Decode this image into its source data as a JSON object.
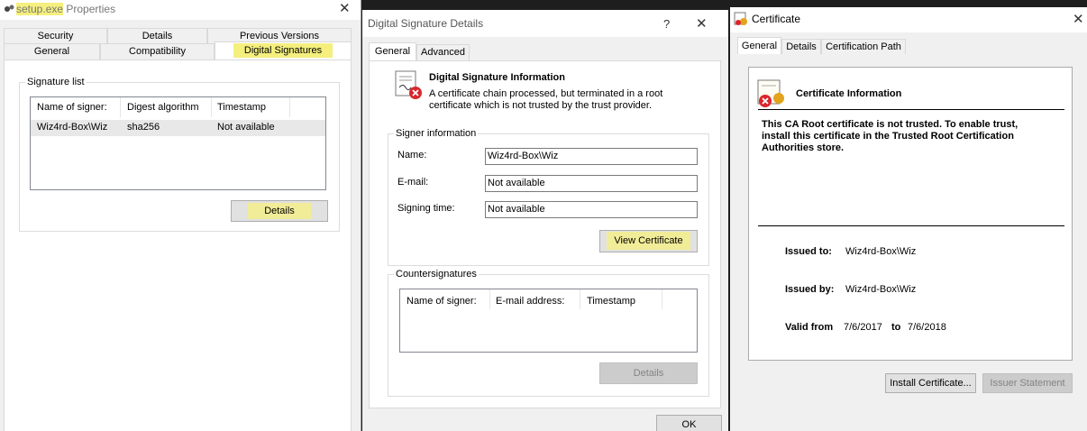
{
  "properties": {
    "title_file": "setup.exe",
    "title_rest": " Properties",
    "tabs_row1": [
      "Security",
      "Details",
      "Previous Versions"
    ],
    "tabs_row2": [
      "General",
      "Compatibility",
      "Digital Signatures"
    ],
    "signature_list_label": "Signature list",
    "columns": [
      "Name of signer:",
      "Digest algorithm",
      "Timestamp"
    ],
    "row": [
      "Wiz4rd-Box\\Wiz",
      "sha256",
      "Not available"
    ],
    "details_button": "Details"
  },
  "sig_details": {
    "title": "Digital Signature Details",
    "help_icon": "?",
    "tabs": [
      "General",
      "Advanced"
    ],
    "info_heading": "Digital Signature Information",
    "info_text_1": "A certificate chain processed, but terminated in a root",
    "info_text_2": "certificate which is not trusted by the trust provider.",
    "signer_group": "Signer information",
    "name_label": "Name:",
    "name_value": "Wiz4rd-Box\\Wiz",
    "email_label": "E-mail:",
    "email_value": "Not available",
    "signing_time_label": "Signing time:",
    "signing_time_value": "Not available",
    "view_certificate_button": "View Certificate",
    "countersig_group": "Countersignatures",
    "countersig_columns": [
      "Name of signer:",
      "E-mail address:",
      "Timestamp"
    ],
    "details_button": "Details",
    "ok_button": "OK"
  },
  "certificate": {
    "title": "Certificate",
    "tabs": [
      "General",
      "Details",
      "Certification Path"
    ],
    "info_heading": "Certificate Information",
    "warning_1": "This CA Root certificate is not trusted. To enable trust,",
    "warning_2": "install this certificate in the Trusted Root Certification",
    "warning_3": "Authorities store.",
    "issued_to_label": "Issued to:",
    "issued_to_value": "Wiz4rd-Box\\Wiz",
    "issued_by_label": "Issued by:",
    "issued_by_value": "Wiz4rd-Box\\Wiz",
    "valid_from_label": "Valid from",
    "valid_from_value": "7/6/2017",
    "to_label": "to",
    "valid_to_value": "7/6/2018",
    "install_button": "Install Certificate...",
    "issuer_statement_button": "Issuer Statement"
  },
  "colors": {
    "highlight": "#f5ef7e",
    "dark_bg": "#1e1e1e",
    "error_red": "#d9262c"
  }
}
